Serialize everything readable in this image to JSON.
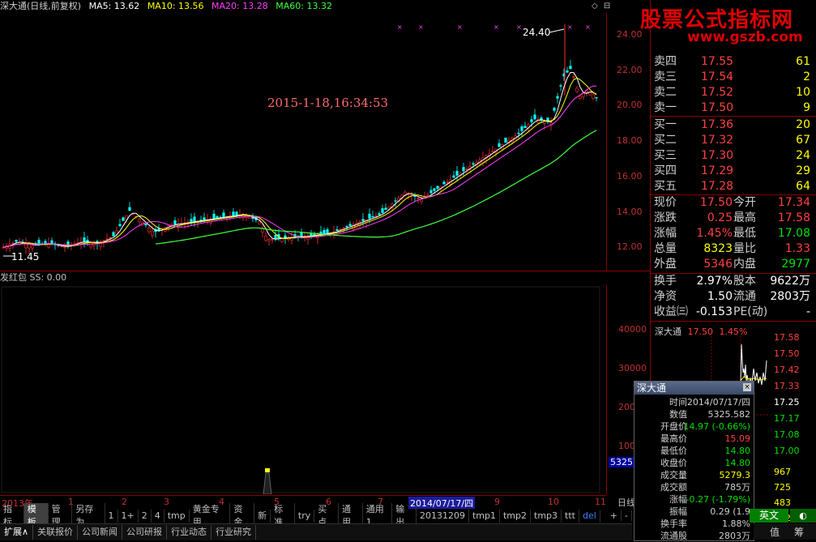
{
  "header": {
    "title": "深大通(日线,前复权)",
    "ma5": "MA5: 13.62",
    "ma10": "MA10: 13.56",
    "ma20": "MA20: 13.28",
    "ma60": "MA60: 13.32",
    "icons": [
      "◇",
      "⊟"
    ]
  },
  "main_chart": {
    "high_label": "24.40",
    "low_label": "11.45",
    "date_annotation": "2015-1-18,16:34:53",
    "price_ticks": [
      "24.00",
      "22.00",
      "20.00",
      "18.00",
      "16.00",
      "14.00",
      "12.00"
    ]
  },
  "sub_chart": {
    "title": "发红包  SS: 0.00",
    "ticks": [
      "40000",
      "30000",
      "20000",
      "10000"
    ],
    "current_value": "5325"
  },
  "timeline": {
    "year": "2013年",
    "months": [
      "1",
      "2",
      "3",
      "4",
      "5",
      "6",
      "7",
      "9",
      "10",
      "11"
    ],
    "highlight": "2014/07/17/四",
    "day_label": "日线"
  },
  "toolbar1": [
    "指标",
    "模板",
    "管理",
    "另存为",
    "1",
    "1+",
    "2",
    "4",
    "tmp",
    "黄金专用",
    "资金",
    "新",
    "标准",
    "try",
    "买点",
    "通用",
    "通用1",
    "输出",
    "20131209",
    "tmp1",
    "tmp2",
    "tmp3",
    "ttt",
    "del"
  ],
  "toolbar1_active": "模板",
  "toolbar1_nav": [
    "+",
    "-"
  ],
  "toolbar2": [
    "扩展∧",
    "关联报价",
    "公司新闻",
    "公司研报",
    "行业动态",
    "行业研究"
  ],
  "watermark": {
    "line1": "股票公式指标网",
    "line2": "www.gszb.com"
  },
  "order_book": {
    "sell": [
      {
        "label": "卖四",
        "price": "17.55",
        "vol": "61"
      },
      {
        "label": "卖三",
        "price": "17.54",
        "vol": "2"
      },
      {
        "label": "卖二",
        "price": "17.52",
        "vol": "10"
      },
      {
        "label": "卖一",
        "price": "17.50",
        "vol": "9"
      }
    ],
    "buy": [
      {
        "label": "买一",
        "price": "17.36",
        "vol": "20"
      },
      {
        "label": "买二",
        "price": "17.32",
        "vol": "67"
      },
      {
        "label": "买三",
        "price": "17.30",
        "vol": "24"
      },
      {
        "label": "买四",
        "price": "17.29",
        "vol": "29"
      },
      {
        "label": "买五",
        "price": "17.28",
        "vol": "64"
      }
    ]
  },
  "stats": [
    {
      "l1": "现价",
      "v1": "17.50",
      "c1": "red",
      "l2": "今开",
      "v2": "17.34",
      "c2": "red"
    },
    {
      "l1": "涨跌",
      "v1": "0.25",
      "c1": "red",
      "l2": "最高",
      "v2": "17.58",
      "c2": "red"
    },
    {
      "l1": "涨幅",
      "v1": "1.45%",
      "c1": "red",
      "l2": "最低",
      "v2": "17.08",
      "c2": "green"
    },
    {
      "l1": "总量",
      "v1": "8323",
      "c1": "yellow",
      "l2": "量比",
      "v2": "1.33",
      "c2": "red"
    },
    {
      "l1": "外盘",
      "v1": "5346",
      "c1": "red",
      "l2": "内盘",
      "v2": "2977",
      "c2": "green"
    }
  ],
  "stats2": [
    {
      "l1": "换手",
      "v1": "2.97%",
      "c1": "white",
      "l2": "股本",
      "v2": "9622万",
      "c2": "white"
    },
    {
      "l1": "净资",
      "v1": "1.50",
      "c1": "white",
      "l2": "流通",
      "v2": "2803万",
      "c2": "white"
    },
    {
      "l1": "收益㈢",
      "v1": "-0.153",
      "c1": "white",
      "l2": "PE(动)",
      "v2": "-",
      "c2": "white"
    }
  ],
  "mini": {
    "name": "深大通",
    "price": "17.50",
    "pct": "1.45%",
    "ticks": [
      {
        "v": "17.58",
        "c": "red"
      },
      {
        "v": "17.50",
        "c": "red"
      },
      {
        "v": "17.42",
        "c": "red"
      },
      {
        "v": "17.33",
        "c": "red"
      },
      {
        "v": "17.25",
        "c": "white"
      },
      {
        "v": "17.17",
        "c": "green"
      },
      {
        "v": "17.08",
        "c": "green"
      },
      {
        "v": "17.00",
        "c": "green"
      }
    ],
    "vol_ticks": [
      "967",
      "725",
      "483",
      "242"
    ]
  },
  "popup": {
    "title": "深大通",
    "rows": [
      {
        "label": "时间",
        "value": "2014/07/17/四",
        "color": "#d0d0d0"
      },
      {
        "label": "数值",
        "value": "5325.582",
        "color": "#d0d0d0"
      },
      {
        "label": "开盘价",
        "value": "14.97 (-0.66%)",
        "color": "#00e000"
      },
      {
        "label": "最高价",
        "value": "15.09",
        "color": "#ff4040"
      },
      {
        "label": "最低价",
        "value": "14.80",
        "color": "#00e000"
      },
      {
        "label": "收盘价",
        "value": "14.80",
        "color": "#00e000"
      },
      {
        "label": "成交量",
        "value": "5279.3",
        "color": "#ffff00"
      },
      {
        "label": "成交额",
        "value": "785万",
        "color": "#d0d0d0"
      },
      {
        "label": "涨幅",
        "value": "-0.27 (-1.79%)",
        "color": "#00e000"
      },
      {
        "label": "振幅",
        "value": "0.29 (1.9",
        "color": "#d0d0d0"
      },
      {
        "label": "换手率",
        "value": "1.88%",
        "color": "#d0d0d0"
      },
      {
        "label": "流通股",
        "value": "2803万",
        "color": "#d0d0d0"
      }
    ]
  },
  "lang_button": "英文",
  "lang_ext": "◐",
  "bottom_right": [
    "值",
    "筹"
  ]
}
